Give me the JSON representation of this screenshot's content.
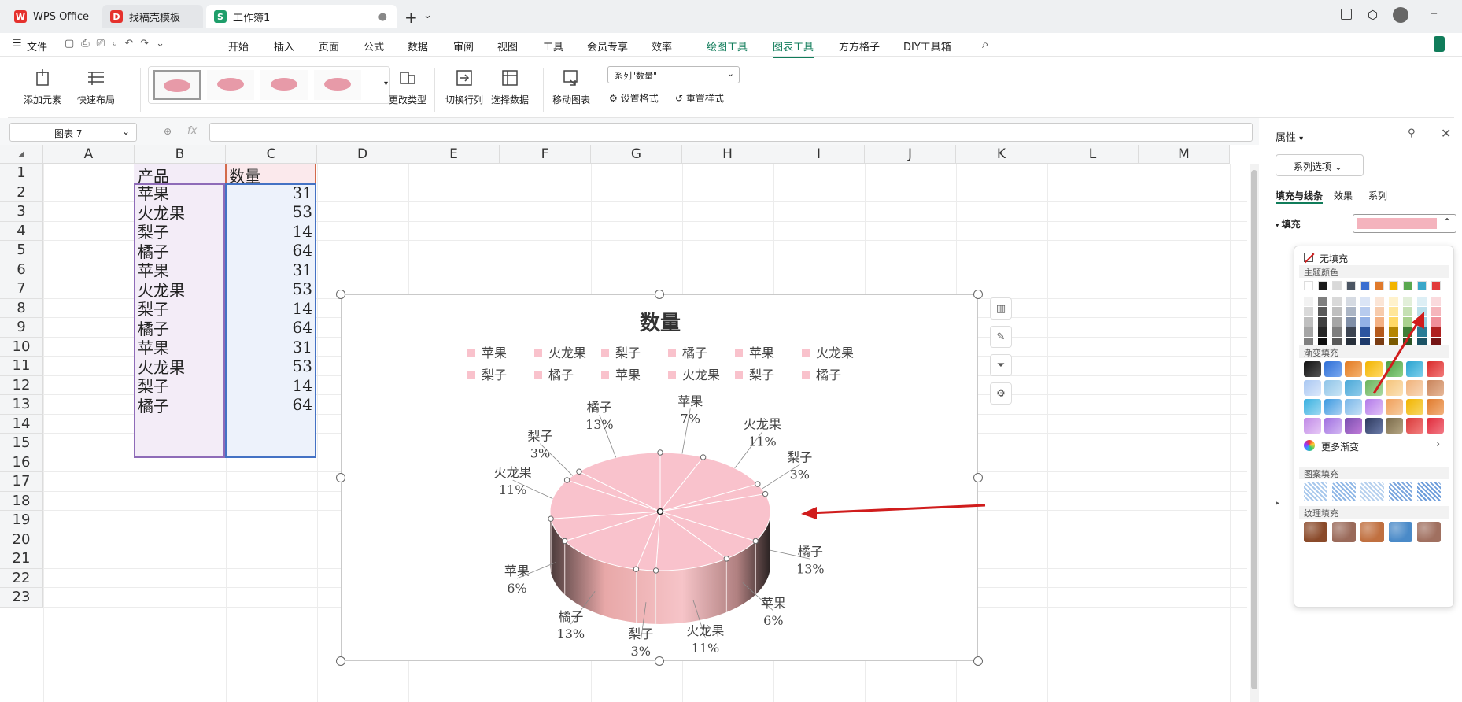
{
  "tabs": {
    "home": "WPS Office",
    "template": "找稿壳模板",
    "workbook": "工作簿1",
    "workbook_badge": "S",
    "new_tab": "+"
  },
  "menu": {
    "file": "文件",
    "items": [
      "开始",
      "插入",
      "页面",
      "公式",
      "数据",
      "审阅",
      "视图",
      "工具",
      "会员专享",
      "效率",
      "绘图工具",
      "图表工具",
      "方方格子",
      "DIY工具箱"
    ],
    "active": "图表工具"
  },
  "ribbon": {
    "add_element": "添加元素",
    "quick_layout": "快速布局",
    "change_type": "更改类型",
    "switch_rowcol": "切换行列",
    "select_data": "选择数据",
    "move_chart": "移动图表",
    "series_select": "系列\"数量\"",
    "set_format": "设置格式",
    "reset_style": "重置样式"
  },
  "formula_bar": {
    "name_box": "图表 7",
    "fx": "fx"
  },
  "sheet": {
    "columns": [
      "A",
      "B",
      "C",
      "D",
      "E",
      "F",
      "G",
      "H",
      "I",
      "J",
      "K",
      "L",
      "M"
    ],
    "rows": [
      "1",
      "2",
      "3",
      "4",
      "5",
      "6",
      "7",
      "8",
      "9",
      "10",
      "11",
      "12",
      "13",
      "14",
      "15",
      "16",
      "17",
      "18",
      "19",
      "20",
      "21",
      "22",
      "23"
    ],
    "header_b": "产品",
    "header_c": "数量",
    "data": [
      [
        "苹果",
        31
      ],
      [
        "火龙果",
        53
      ],
      [
        "梨子",
        14
      ],
      [
        "橘子",
        64
      ],
      [
        "苹果",
        31
      ],
      [
        "火龙果",
        53
      ],
      [
        "梨子",
        14
      ],
      [
        "橘子",
        64
      ],
      [
        "苹果",
        31
      ],
      [
        "火龙果",
        53
      ],
      [
        "梨子",
        14
      ],
      [
        "橘子",
        64
      ]
    ]
  },
  "chart_data": {
    "type": "pie",
    "title": "数量",
    "categories": [
      "苹果",
      "火龙果",
      "梨子",
      "橘子",
      "苹果",
      "火龙果",
      "梨子",
      "橘子",
      "苹果",
      "火龙果",
      "梨子",
      "橘子"
    ],
    "values": [
      31,
      53,
      14,
      64,
      31,
      53,
      14,
      64,
      31,
      53,
      14,
      64
    ],
    "data_labels": [
      {
        "name": "苹果",
        "pct": "7%"
      },
      {
        "name": "火龙果",
        "pct": "11%"
      },
      {
        "name": "梨子",
        "pct": "3%"
      },
      {
        "name": "橘子",
        "pct": "13%"
      },
      {
        "name": "苹果",
        "pct": "6%"
      },
      {
        "name": "火龙果",
        "pct": "11%"
      },
      {
        "name": "梨子",
        "pct": "3%"
      },
      {
        "name": "橘子",
        "pct": "13%"
      },
      {
        "name": "苹果",
        "pct": "6%"
      },
      {
        "name": "火龙果",
        "pct": "11%"
      },
      {
        "name": "梨子",
        "pct": "3%"
      },
      {
        "name": "橘子",
        "pct": "13%"
      }
    ],
    "legend": [
      "苹果",
      "火龙果",
      "梨子",
      "橘子",
      "苹果",
      "火龙果",
      "梨子",
      "橘子",
      "苹果",
      "火龙果",
      "梨子",
      "橘子"
    ],
    "legend_position": "top",
    "slice_color": "#f9c2cc",
    "style": "3d"
  },
  "panel": {
    "title": "属性",
    "series_options": "系列选项",
    "tabs": [
      "填充与线条",
      "效果",
      "系列"
    ],
    "fill_label": "填充",
    "fill_color": "#f4b3bd"
  },
  "color_popup": {
    "no_fill": "无填充",
    "theme_colors": "主题颜色",
    "gradient_fill": "渐变填充",
    "more_gradient": "更多渐变",
    "pattern_fill": "图案填充",
    "texture_fill": "纹理填充"
  },
  "colors": {
    "accent": "#107c5a",
    "selection_b": "#8e6bb8",
    "selection_c": "#4472c4",
    "arrow": "#d01c1c"
  }
}
